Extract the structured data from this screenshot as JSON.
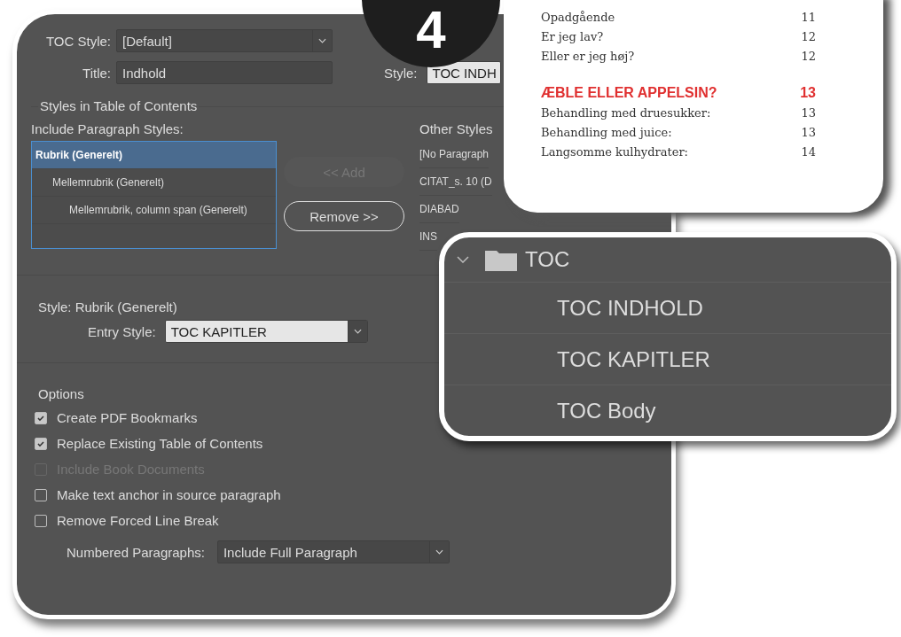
{
  "badge": {
    "number": "4"
  },
  "dialog": {
    "toc_style": {
      "label": "TOC Style:",
      "value": "[Default]"
    },
    "title": {
      "label": "Title:",
      "value": "Indhold"
    },
    "title_style": {
      "label": "Style:",
      "value": "TOC INDH"
    },
    "styles_section": {
      "heading": "Styles in Table of Contents",
      "include_label": "Include Paragraph Styles:",
      "included": [
        {
          "name": "Rubrik (Generelt)",
          "selected": true,
          "children": [
            {
              "name": "Mellemrubrik (Generelt)",
              "selected": false,
              "children": [
                {
                  "name": "Mellemrubrik, column span (Generelt)",
                  "selected": false
                }
              ]
            }
          ]
        }
      ],
      "add_button": {
        "label": "<< Add",
        "disabled": true
      },
      "remove_button": {
        "label": "Remove >>",
        "disabled": false
      },
      "other_label": "Other Styles",
      "other_styles": [
        "[No Paragraph",
        "CITAT_s. 10 (D",
        "DIABAD",
        "INS"
      ]
    },
    "style_section": {
      "heading": "Style: Rubrik (Generelt)",
      "entry_label": "Entry Style:",
      "entry_value": "TOC KAPITLER"
    },
    "options": {
      "heading": "Options",
      "checkboxes": [
        {
          "label": "Create PDF Bookmarks",
          "checked": true,
          "disabled": false
        },
        {
          "label": "Replace Existing Table of Contents",
          "checked": true,
          "disabled": false
        },
        {
          "label": "Include Book Documents",
          "checked": false,
          "disabled": true
        },
        {
          "label": "Make text anchor in source paragraph",
          "checked": false,
          "disabled": false
        },
        {
          "label": "Remove Forced Line Break",
          "checked": false,
          "disabled": false
        }
      ],
      "numbered_label": "Numbered Paragraphs:",
      "numbered_value": "Include Full Paragraph"
    }
  },
  "toc_preview": {
    "entries": [
      {
        "kind": "entry",
        "text": "Opadgående",
        "page": "11"
      },
      {
        "kind": "entry",
        "text": "Er jeg lav?",
        "page": "12"
      },
      {
        "kind": "entry",
        "text": "Eller er jeg høj?",
        "page": "12"
      },
      {
        "kind": "heading",
        "text": "ÆBLE ELLER APPELSIN?",
        "page": "13"
      },
      {
        "kind": "entry",
        "text": "Behandling med druesukker:",
        "page": "13"
      },
      {
        "kind": "entry",
        "text": "Behandling med juice:",
        "page": "13"
      },
      {
        "kind": "entry",
        "text": "Langsomme kulhydrater:",
        "page": "14"
      }
    ]
  },
  "styles_panel": {
    "group": {
      "name": "TOC",
      "expanded": true
    },
    "items": [
      "TOC INDHOLD",
      "TOC KAPITLER",
      "TOC Body"
    ]
  }
}
